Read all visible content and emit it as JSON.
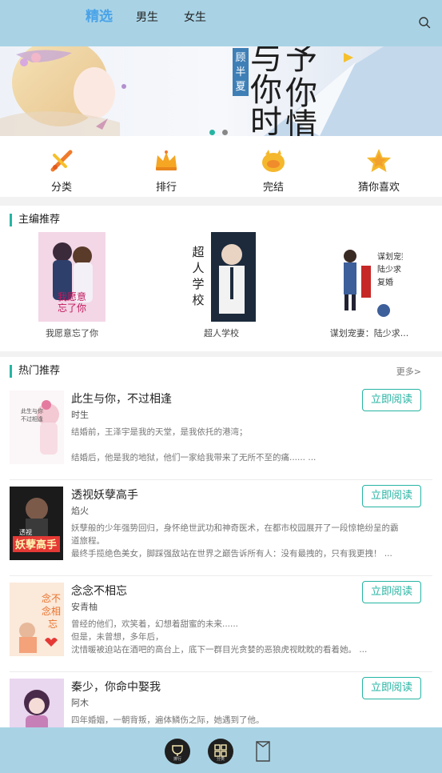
{
  "header": {
    "tabs": [
      {
        "label": "精选",
        "active": true
      },
      {
        "label": "男生",
        "active": false
      },
      {
        "label": "女生",
        "active": false
      }
    ],
    "search_icon": "search-icon"
  },
  "banner": {
    "author": "顾半夏",
    "title_chars": [
      "与",
      "你",
      "你",
      "时",
      "情"
    ],
    "active_dot": 0,
    "dot_count": 2
  },
  "categories": [
    {
      "label": "分类",
      "icon": "sword-icon"
    },
    {
      "label": "排行",
      "icon": "crown-icon"
    },
    {
      "label": "完结",
      "icon": "finished-badge-icon"
    },
    {
      "label": "猜你喜欢",
      "icon": "star-icon"
    }
  ],
  "editor": {
    "title": "主编推荐",
    "books": [
      {
        "name": "我愿意忘了你",
        "cover_text": "我愿意忘了你"
      },
      {
        "name": "超人学校",
        "cover_text": "超人学校"
      },
      {
        "name": "谋划宠妻：陆少求...",
        "cover_text": "谋划宠妻 陆少求复婚"
      }
    ]
  },
  "hot": {
    "title": "热门推荐",
    "more": "更多>",
    "read_label": "立即阅读",
    "items": [
      {
        "title": "此生与你，不过相逢",
        "author": "时生",
        "desc": [
          "结婚前，王泽宇是我的天堂，是我依托的港湾；",
          "",
          "结婚后，他是我的地狱，他们一家给我带来了无所不至的痛...... ..."
        ]
      },
      {
        "title": "透视妖孽高手",
        "author": "焰火",
        "desc": [
          "妖孽般的少年强势回归，身怀绝世武功和神奇医术，在都市校园展开了一段惊艳纷呈的霸",
          "道旅程。",
          "最终手揽绝色美女，脚踩强敌站在世界之巅告诉所有人：没有最拽的，只有我更拽！ ..."
        ],
        "cover_text": "透视 妖孽高手"
      },
      {
        "title": "念念不相忘",
        "author": "安青柚",
        "desc": [
          "曾经的他们，欢笑着，幻想着甜蜜的未来......",
          "但是，未曾想，多年后，",
          "沈惜暖被迫站在酒吧的高台上，底下一群目光贪婪的恶狼虎视眈眈的看着她。 ..."
        ],
        "cover_text": "念念不相忘"
      },
      {
        "title": "秦少，你命中娶我",
        "author": "阿木",
        "desc": [
          "四年婚姻，一朝背叛，遍体鳞伤之际，她遇到了他。"
        ]
      }
    ]
  },
  "bottom_nav": [
    {
      "label": "排行",
      "icon": "rank-icon"
    },
    {
      "label": "分类",
      "icon": "grid-icon"
    },
    {
      "label": "",
      "icon": "bookshelf-icon"
    }
  ],
  "colors": {
    "bar": "#a9d3e5",
    "accent": "#26b5a3",
    "tab_active": "#4aa3e8"
  }
}
